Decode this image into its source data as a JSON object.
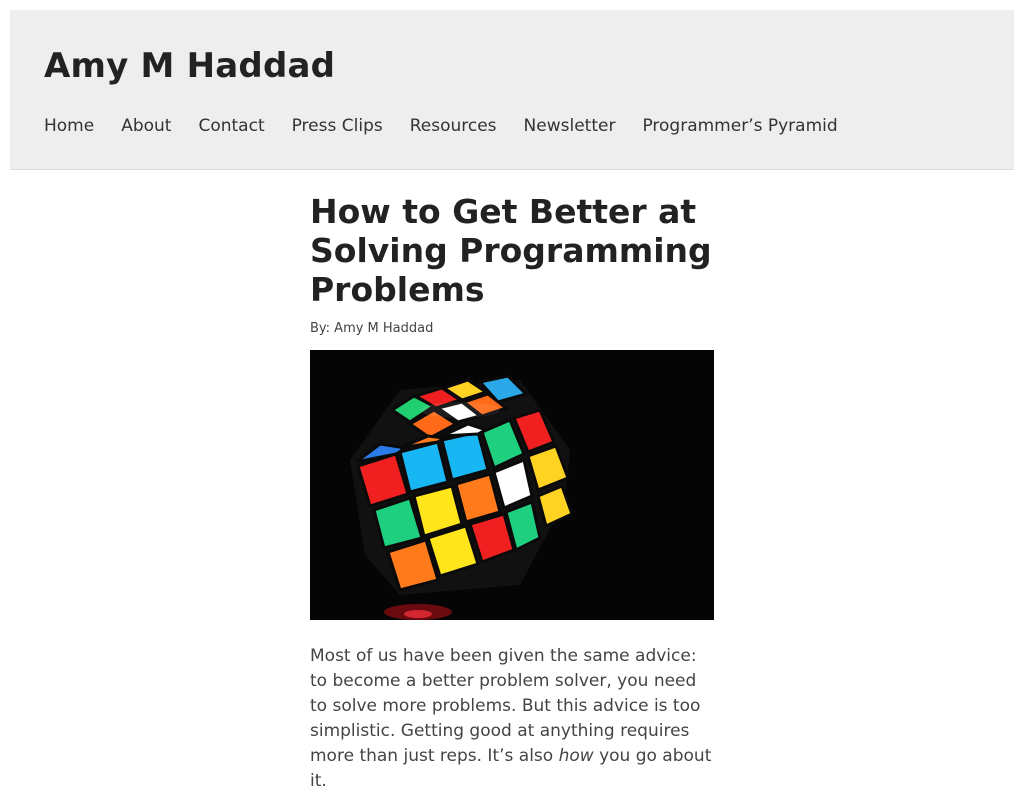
{
  "site": {
    "title": "Amy M Haddad"
  },
  "nav": {
    "items": [
      {
        "label": "Home"
      },
      {
        "label": "About"
      },
      {
        "label": "Contact"
      },
      {
        "label": "Press Clips"
      },
      {
        "label": "Resources"
      },
      {
        "label": "Newsletter"
      },
      {
        "label": "Programmer’s Pyramid"
      }
    ]
  },
  "post": {
    "title": "How to Get Better at Solving Programming Problems",
    "byline": "By: Amy M Haddad",
    "hero_icon": "rubiks-cube-photo",
    "paragraph": {
      "before_em": "Most of us have been given the same advice: to become a better problem solver, you need to solve more problems. But this advice is too simplistic. Getting good at anything requires more than just reps. It’s also ",
      "em": "how",
      "after_em": " you go about it."
    }
  },
  "colors": {
    "header_bg": "#eeeeee",
    "text": "#222222",
    "body_text": "#444444"
  }
}
